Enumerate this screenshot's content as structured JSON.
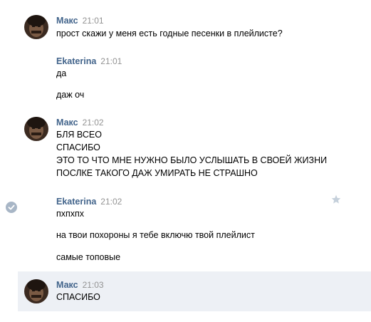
{
  "messages": [
    {
      "author": "Макс",
      "time": "21:01",
      "lines": [
        "прост скажи у меня есть годные песенки в плейлисте?"
      ]
    },
    {
      "author": "Ekaterina",
      "time": "21:01",
      "lines": [
        "да",
        "даж оч"
      ]
    },
    {
      "author": "Макс",
      "time": "21:02",
      "lines": [
        "БЛЯ ВСЕО",
        "СПАСИБО",
        "ЭТО ТО ЧТО МНЕ НУЖНО БЫЛО УСЛЫШАТЬ В СВОЕЙ ЖИЗНИ",
        "ПОСЛКЕ ТАКОГО ДАЖ УМИРАТЬ НЕ СТРАШНО"
      ]
    },
    {
      "author": "Ekaterina",
      "time": "21:02",
      "lines": [
        "пхпхпх",
        "на твои похороны я тебе включю твой плейлист",
        "самые топовые"
      ]
    },
    {
      "author": "Макс",
      "time": "21:03",
      "lines": [
        "СПАСИБО"
      ]
    }
  ],
  "icons": {
    "read_check": "check-circle-icon",
    "favorite": "star-icon"
  },
  "colors": {
    "author": "#42648b",
    "time": "#939393",
    "highlight_bg": "#edf0f5"
  }
}
